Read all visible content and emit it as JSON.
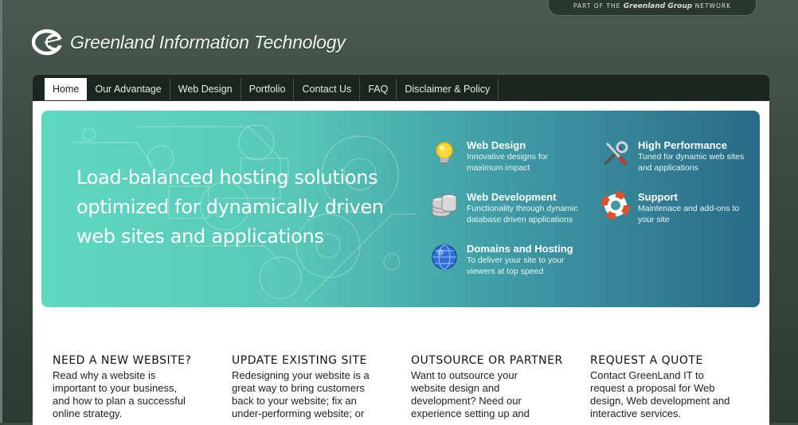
{
  "network": {
    "prefix": "PART OF THE",
    "brand": "Greenland Group",
    "suffix": "NETWORK"
  },
  "site": {
    "title": "Greenland Information Technology"
  },
  "nav": [
    {
      "label": "Home",
      "active": true
    },
    {
      "label": "Our Advantage"
    },
    {
      "label": "Web Design"
    },
    {
      "label": "Portfolio"
    },
    {
      "label": "Contact Us"
    },
    {
      "label": "FAQ"
    },
    {
      "label": "Disclaimer & Policy"
    }
  ],
  "hero": {
    "lines": [
      "Load-balanced hosting solutions",
      "optimized for dynamically driven",
      "web sites and applications"
    ]
  },
  "features": [
    {
      "icon": "lightbulb-icon",
      "title": "Web Design",
      "desc": [
        "Innovative designs for",
        "maximum impact"
      ]
    },
    {
      "icon": "tools-icon",
      "title": "High Performance",
      "desc": [
        "Tuned for dynamic web sites",
        "and applications"
      ]
    },
    {
      "icon": "database-icon",
      "title": "Web Development",
      "desc": [
        "Functionality through dynamic",
        "database driven applications"
      ]
    },
    {
      "icon": "lifebuoy-icon",
      "title": "Support",
      "desc": [
        "Maintenace and add-ons to",
        "your site"
      ]
    },
    {
      "icon": "globe-icon",
      "title": "Domains and Hosting",
      "desc": [
        "To deliver your site to your",
        "viewers at top speed"
      ]
    }
  ],
  "columns": [
    {
      "title": "NEED A NEW WEBSITE?",
      "text": [
        "Read why a website is",
        "important to your business,",
        "and how to plan a successful",
        "online strategy."
      ]
    },
    {
      "title": "UPDATE EXISTING SITE",
      "text": [
        "Redesigning your website is a",
        "great way to bring customers",
        "back to your website; fix an",
        "under-performing website; or"
      ]
    },
    {
      "title": "OUTSOURCE OR PARTNER",
      "text": [
        "Want to outsource your",
        "website design and",
        "development? Need our",
        "experience setting up and"
      ]
    },
    {
      "title": "REQUEST A QUOTE",
      "text": [
        "Contact GreenLand IT to",
        "request a proposal for Web",
        "design, Web development and",
        "interactive services."
      ]
    }
  ]
}
